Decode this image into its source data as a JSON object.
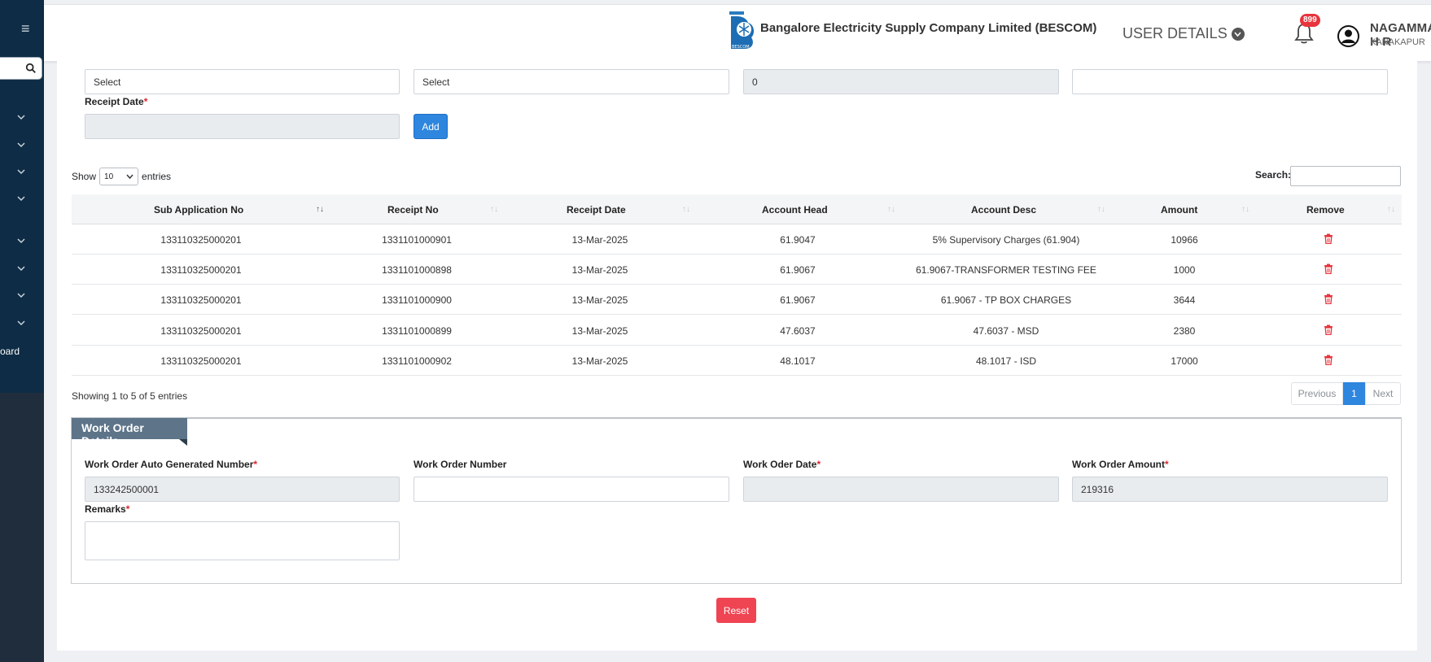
{
  "header": {
    "company": "Bangalore Electricity Supply Company Limited (BESCOM)",
    "logo_caption": "BESCOM",
    "user_details": "USER DETAILS",
    "notification_count": "899",
    "user_name": "NAGAMMA H R",
    "user_location": "KANAKAPUR"
  },
  "sidebar": {
    "dashboard_label": "oard"
  },
  "form": {
    "select1": "Select",
    "select2": "Select",
    "field3_value": "0",
    "field4_value": "",
    "receipt_date_label": "Receipt Date",
    "add_label": "Add"
  },
  "table_controls": {
    "show": "Show",
    "entries_value": "10",
    "entries": "entries",
    "search": "Search:"
  },
  "table": {
    "headers": [
      "Sub Application No",
      "Receipt No",
      "Receipt Date",
      "Account Head",
      "Account Desc",
      "Amount",
      "Remove"
    ],
    "rows": [
      [
        "133110325000201",
        "1331101000901",
        "13-Mar-2025",
        "61.9047",
        "5% Supervisory Charges (61.904)",
        "10966"
      ],
      [
        "133110325000201",
        "1331101000898",
        "13-Mar-2025",
        "61.9067",
        "61.9067-TRANSFORMER TESTING FEE",
        "1000"
      ],
      [
        "133110325000201",
        "1331101000900",
        "13-Mar-2025",
        "61.9067",
        "61.9067 - TP BOX CHARGES",
        "3644"
      ],
      [
        "133110325000201",
        "1331101000899",
        "13-Mar-2025",
        "47.6037",
        "47.6037 - MSD",
        "2380"
      ],
      [
        "133110325000201",
        "1331101000902",
        "13-Mar-2025",
        "48.1017",
        "48.1017 - ISD",
        "17000"
      ]
    ],
    "showing": "Showing 1 to 5 of 5 entries",
    "pager": {
      "previous": "Previous",
      "page": "1",
      "next": "Next"
    }
  },
  "work_order": {
    "title": "Work Order Details",
    "auto_number_label": "Work Order Auto Generated Number",
    "auto_number_value": "133242500001",
    "number_label": "Work Order Number",
    "number_value": "",
    "date_label": "Work Oder Date",
    "date_value": "",
    "amount_label": "Work Order Amount",
    "amount_value": "219316",
    "remarks_label": "Remarks",
    "remarks_value": ""
  },
  "reset_label": "Reset",
  "colors": {
    "primary": "#2e86de",
    "danger": "#ef4452",
    "sidebar": "#0e2c45",
    "section_tab": "#5d7489"
  }
}
